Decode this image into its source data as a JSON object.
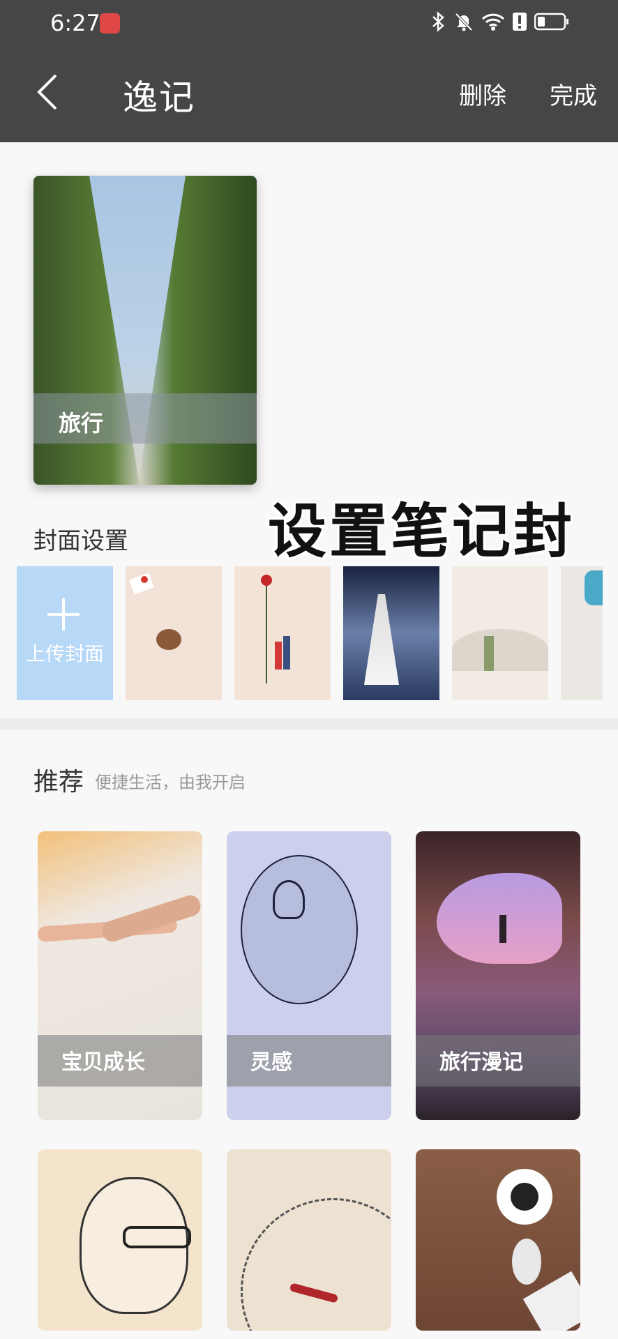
{
  "status_bar": {
    "time": "6:27"
  },
  "header": {
    "title": "逸记",
    "delete_label": "删除",
    "done_label": "完成"
  },
  "current_cover": {
    "label": "旅行"
  },
  "overlay_caption": "设置笔记封面",
  "cover_settings": {
    "title": "封面设置",
    "upload_label": "上传封面"
  },
  "recommend": {
    "title": "推荐",
    "subtitle": "便捷生活，由我开启",
    "cards": [
      {
        "label": "宝贝成长"
      },
      {
        "label": "灵感"
      },
      {
        "label": "旅行漫记"
      }
    ]
  }
}
